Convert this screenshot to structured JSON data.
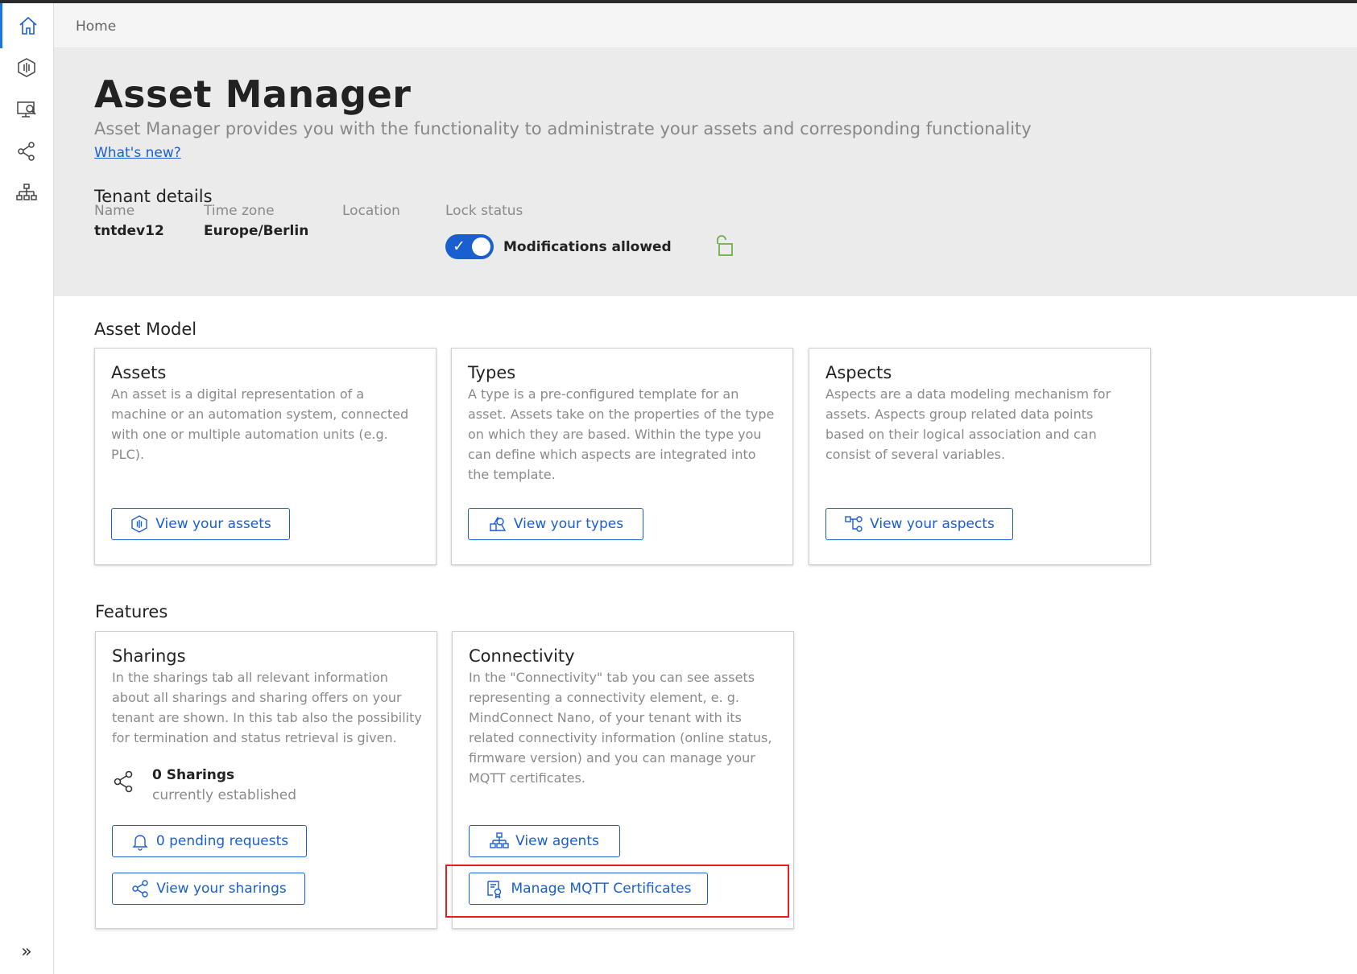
{
  "breadcrumb": {
    "home": "Home"
  },
  "sidebar": {
    "items": [
      {
        "icon": "home-icon",
        "active": true
      },
      {
        "icon": "asset-icon",
        "active": false
      },
      {
        "icon": "monitor-search-icon",
        "active": false
      },
      {
        "icon": "share-icon",
        "active": false
      },
      {
        "icon": "hierarchy-icon",
        "active": false
      }
    ],
    "expand": "»"
  },
  "header": {
    "title": "Asset Manager",
    "subtitle": "Asset Manager provides you with the functionality to administrate your assets and corresponding functionality",
    "whats_new": "What's new?",
    "tenant_details": "Tenant details",
    "name_label": "Name",
    "name_value": "tntdev12",
    "timezone_label": "Time zone",
    "timezone_value": "Europe/Berlin",
    "location_label": "Location",
    "lock_label": "Lock status",
    "lock_text": "Modifications allowed",
    "lock_toggle_on": true
  },
  "asset_model": {
    "title": "Asset Model",
    "cards": [
      {
        "title": "Assets",
        "desc": "An asset is a digital representation of a machine or an automation system, connected with one or multiple automation units (e.g. PLC).",
        "button": "View your assets"
      },
      {
        "title": "Types",
        "desc": "A type is a pre-configured template for an asset. Assets take on the properties of the type on which they are based. Within the type you can define which aspects are integrated into the template.",
        "button": "View your types"
      },
      {
        "title": "Aspects",
        "desc": "Aspects are a data modeling mechanism for assets. Aspects group related data points based on their logical association and can consist of several variables.",
        "button": "View your aspects"
      }
    ]
  },
  "features": {
    "title": "Features",
    "sharings": {
      "title": "Sharings",
      "desc": "In the sharings tab all relevant information about all sharings and sharing offers on your tenant are shown. In this tab also the possibility for termination and status retrieval is given.",
      "count": "0 Sharings",
      "count_sub": "currently established",
      "pending_button": "0 pending requests",
      "view_button": "View your sharings"
    },
    "connectivity": {
      "title": "Connectivity",
      "desc": "In the \"Connectivity\" tab you can see assets representing a connectivity element, e. g. MindConnect Nano, of your tenant with its related connectivity information (online status, firmware version) and you can manage your MQTT certificates.",
      "agents_button": "View agents",
      "mqtt_button": "Manage MQTT Certificates"
    }
  },
  "colors": {
    "accent": "#1a5fd0",
    "lock": "#6ab04c",
    "highlight": "#e02020"
  }
}
